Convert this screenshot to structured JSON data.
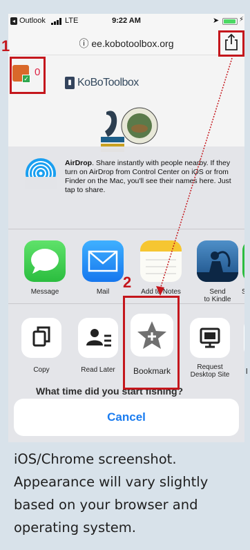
{
  "status_bar": {
    "back_app": "Outlook",
    "network": "LTE",
    "time": "9:22 AM"
  },
  "address_bar": {
    "url": "ee.kobotoolbox.org"
  },
  "page": {
    "count": "0",
    "brand": "KoBoToolbox",
    "question": "What time did you start fishing?"
  },
  "airdrop": {
    "title": "AirDrop",
    "text": ". Share instantly with people nearby. If they turn on AirDrop from Control Center on iOS or from Finder on the Mac, you'll see their names here. Just tap to share."
  },
  "apps": [
    {
      "label": "Message",
      "icon": "messages-icon",
      "color": "#34c759"
    },
    {
      "label": "Mail",
      "icon": "mail-icon",
      "color": "#1a8cf6"
    },
    {
      "label": "Add to Notes",
      "icon": "notes-icon",
      "color": "#fcd34d"
    },
    {
      "label": "Send\nto Kindle",
      "icon": "kindle-icon",
      "color": "#2f6fa8"
    },
    {
      "label": "Sa",
      "icon": "save-icon",
      "color": "#34c759"
    }
  ],
  "actions": [
    {
      "label": "Copy",
      "icon": "copy-icon"
    },
    {
      "label": "Read Later",
      "icon": "read-later-icon"
    },
    {
      "label": "Bookmark",
      "icon": "bookmark-star-icon"
    },
    {
      "label": "Request\nDesktop Site",
      "icon": "desktop-icon"
    }
  ],
  "cancel_label": "Cancel",
  "annotations": {
    "step1": "1",
    "step2": "2",
    "color": "#c4161c"
  },
  "caption": "iOS/Chrome screenshot. Appearance will vary slightly based on your browser and operating system."
}
